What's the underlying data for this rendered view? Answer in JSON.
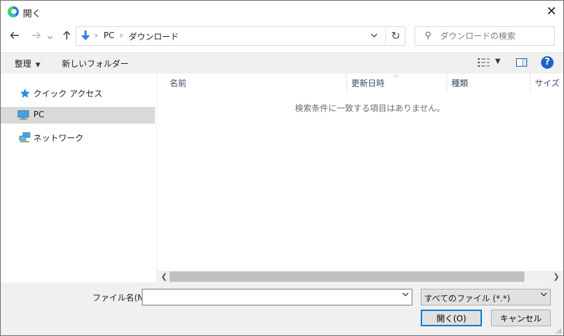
{
  "window": {
    "title": "開く",
    "close_label": "✕"
  },
  "nav": {
    "back_icon": "arrow-left-icon",
    "forward_icon": "arrow-right-icon",
    "recent_icon": "chevron-down-icon",
    "up_icon": "arrow-up-icon",
    "breadcrumbs": [
      "PC",
      "ダウンロード"
    ],
    "separator": "›",
    "refresh_glyph": "↻",
    "dropdown_glyph": "⌵"
  },
  "search": {
    "placeholder": "ダウンロードの検索"
  },
  "toolbar": {
    "organize_label": "整理",
    "new_folder_label": "新しいフォルダー",
    "help_label": "?"
  },
  "sidebar": {
    "items": [
      {
        "label": "クイック アクセス",
        "icon": "star-icon",
        "selected": false
      },
      {
        "label": "PC",
        "icon": "computer-icon",
        "selected": true
      },
      {
        "label": "ネットワーク",
        "icon": "network-icon",
        "selected": false
      }
    ]
  },
  "content": {
    "columns": [
      "名前",
      "更新日時",
      "種類",
      "サイズ"
    ],
    "sort_column": "更新日時",
    "empty_message": "検索条件に一致する項目はありません。"
  },
  "footer": {
    "filename_label": "ファイル名(N):",
    "filename_value": "",
    "filetype_value": "すべてのファイル (*.*)",
    "open_label": "開く(O)",
    "cancel_label": "キャンセル"
  },
  "colors": {
    "accent": "#0078d7",
    "selection": "#d9d9d9",
    "toolbar_bg": "#f0f0f0",
    "help": "#1d65c4"
  }
}
